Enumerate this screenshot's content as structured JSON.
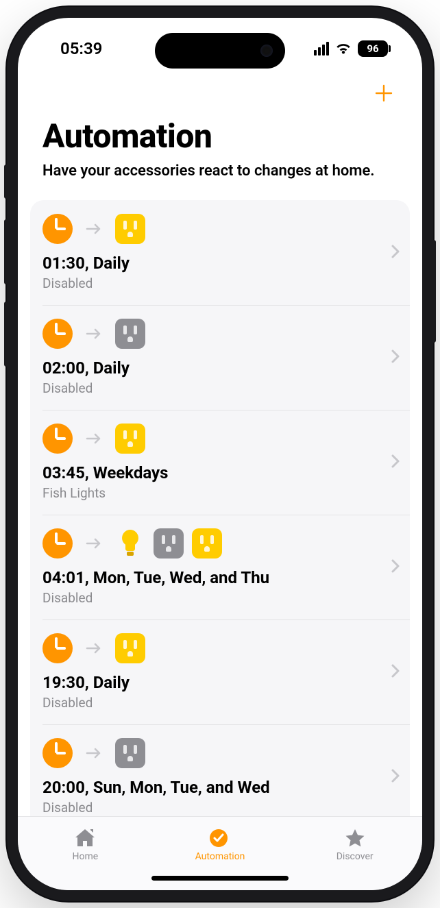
{
  "status": {
    "time": "05:39",
    "battery": "96"
  },
  "page": {
    "title": "Automation",
    "subtitle": "Have your accessories react to changes at home."
  },
  "automations": [
    {
      "title": "01:30, Daily",
      "subtitle": "Disabled",
      "accessories": [
        {
          "kind": "outlet",
          "tone": "yellow"
        }
      ]
    },
    {
      "title": "02:00, Daily",
      "subtitle": "Disabled",
      "accessories": [
        {
          "kind": "outlet",
          "tone": "gray"
        }
      ]
    },
    {
      "title": "03:45, Weekdays",
      "subtitle": "Fish Lights",
      "accessories": [
        {
          "kind": "outlet",
          "tone": "yellow"
        }
      ]
    },
    {
      "title": "04:01, Mon, Tue, Wed, and Thu",
      "subtitle": "Disabled",
      "accessories": [
        {
          "kind": "bulb",
          "tone": "yellow"
        },
        {
          "kind": "outlet",
          "tone": "gray"
        },
        {
          "kind": "outlet",
          "tone": "yellow"
        }
      ]
    },
    {
      "title": "19:30, Daily",
      "subtitle": "Disabled",
      "accessories": [
        {
          "kind": "outlet",
          "tone": "yellow"
        }
      ]
    },
    {
      "title": "20:00, Sun, Mon, Tue, and Wed",
      "subtitle": "Disabled",
      "accessories": [
        {
          "kind": "outlet",
          "tone": "gray"
        }
      ]
    }
  ],
  "tabs": {
    "home": "Home",
    "automation": "Automation",
    "discover": "Discover"
  }
}
